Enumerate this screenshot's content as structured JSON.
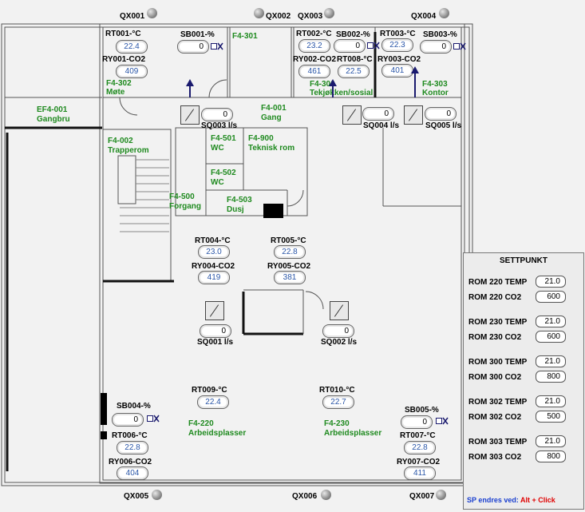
{
  "outputs": {
    "qx001": "QX001",
    "qx002": "QX002",
    "qx003": "QX003",
    "qx004": "QX004",
    "qx005": "QX005",
    "qx006": "QX006",
    "qx007": "QX007"
  },
  "rooms": {
    "r301": "F4-301",
    "r302a": "F4-302",
    "r302b": "Møte",
    "r300a": "F4-300",
    "r300b": "Tekjøkken/sosial",
    "r303a": "F4-303",
    "r303b": "Kontor",
    "ef001a": "EF4-001",
    "ef001b": "Gangbru",
    "r001a": "F4-001",
    "r001b": "Gang",
    "r002a": "F4-002",
    "r002b": "Trapperom",
    "r501a": "F4-501",
    "r501b": "WC",
    "r900a": "F4-900",
    "r900b": "Teknisk rom",
    "r502a": "F4-502",
    "r502b": "WC",
    "r500a": "F4-500",
    "r500b": "Forgang",
    "r503a": "F4-503",
    "r503b": "Dusj",
    "r220a": "F4-220",
    "r220b": "Arbeidsplasser",
    "r230a": "F4-230",
    "r230b": "Arbeidsplasser"
  },
  "sensors": {
    "rt001": {
      "label": "RT001-°C",
      "value": "22.4"
    },
    "ry001": {
      "label": "RY001-CO2",
      "value": "409"
    },
    "sb001": {
      "label": "SB001-%",
      "value": "0"
    },
    "rt002": {
      "label": "RT002-°C",
      "value": "23.2"
    },
    "ry002": {
      "label": "RY002-CO2",
      "value": "461"
    },
    "sb002": {
      "label": "SB002-%",
      "value": "0"
    },
    "rt008": {
      "label": "RT008-°C",
      "value": "22.5"
    },
    "rt003": {
      "label": "RT003-°C",
      "value": "22.3"
    },
    "ry003": {
      "label": "RY003-CO2",
      "value": "401"
    },
    "sb003": {
      "label": "SB003-%",
      "value": "0"
    },
    "sq003": {
      "label": "SQ003 l/s",
      "value": "0"
    },
    "sq004": {
      "label": "SQ004 l/s",
      "value": "0"
    },
    "sq005": {
      "label": "SQ005 l/s",
      "value": "0"
    },
    "rt004": {
      "label": "RT004-°C",
      "value": "23.0"
    },
    "ry004": {
      "label": "RY004-CO2",
      "value": "419"
    },
    "rt005": {
      "label": "RT005-°C",
      "value": "22.8"
    },
    "ry005": {
      "label": "RY005-CO2",
      "value": "381"
    },
    "sq001": {
      "label": "SQ001 l/s",
      "value": "0"
    },
    "sq002": {
      "label": "SQ002 l/s",
      "value": "0"
    },
    "rt009": {
      "label": "RT009-°C",
      "value": "22.4"
    },
    "rt010": {
      "label": "RT010-°C",
      "value": "22.7"
    },
    "sb004": {
      "label": "SB004-%",
      "value": "0"
    },
    "rt006": {
      "label": "RT006-°C",
      "value": "22.8"
    },
    "ry006": {
      "label": "RY006-CO2",
      "value": "404"
    },
    "sb005": {
      "label": "SB005-%",
      "value": "0"
    },
    "rt007": {
      "label": "RT007-°C",
      "value": "22.8"
    },
    "ry007": {
      "label": "RY007-CO2",
      "value": "411"
    }
  },
  "setpoints": {
    "title": "SETTPUNKT",
    "items": [
      {
        "label": "ROM 220 TEMP",
        "value": "21.0"
      },
      {
        "label": "ROM 220 CO2",
        "value": "600"
      },
      {
        "label": "ROM 230 TEMP",
        "value": "21.0"
      },
      {
        "label": "ROM 230 CO2",
        "value": "600"
      },
      {
        "label": "ROM 300 TEMP",
        "value": "21.0"
      },
      {
        "label": "ROM 300 CO2",
        "value": "800"
      },
      {
        "label": "ROM 302 TEMP",
        "value": "21.0"
      },
      {
        "label": "ROM 302 CO2",
        "value": "500"
      },
      {
        "label": "ROM 303 TEMP",
        "value": "21.0"
      },
      {
        "label": "ROM 303 CO2",
        "value": "800"
      }
    ],
    "hint_prefix": "SP endres ved:",
    "hint_action": "Alt + Click",
    "hint_prefix_color": "#1a3fd0",
    "hint_action_color": "#e00000"
  },
  "colors": {
    "room_text": "#1f8a1f",
    "value_text": "#2a56a8",
    "arrow": "#1a1a6e"
  }
}
